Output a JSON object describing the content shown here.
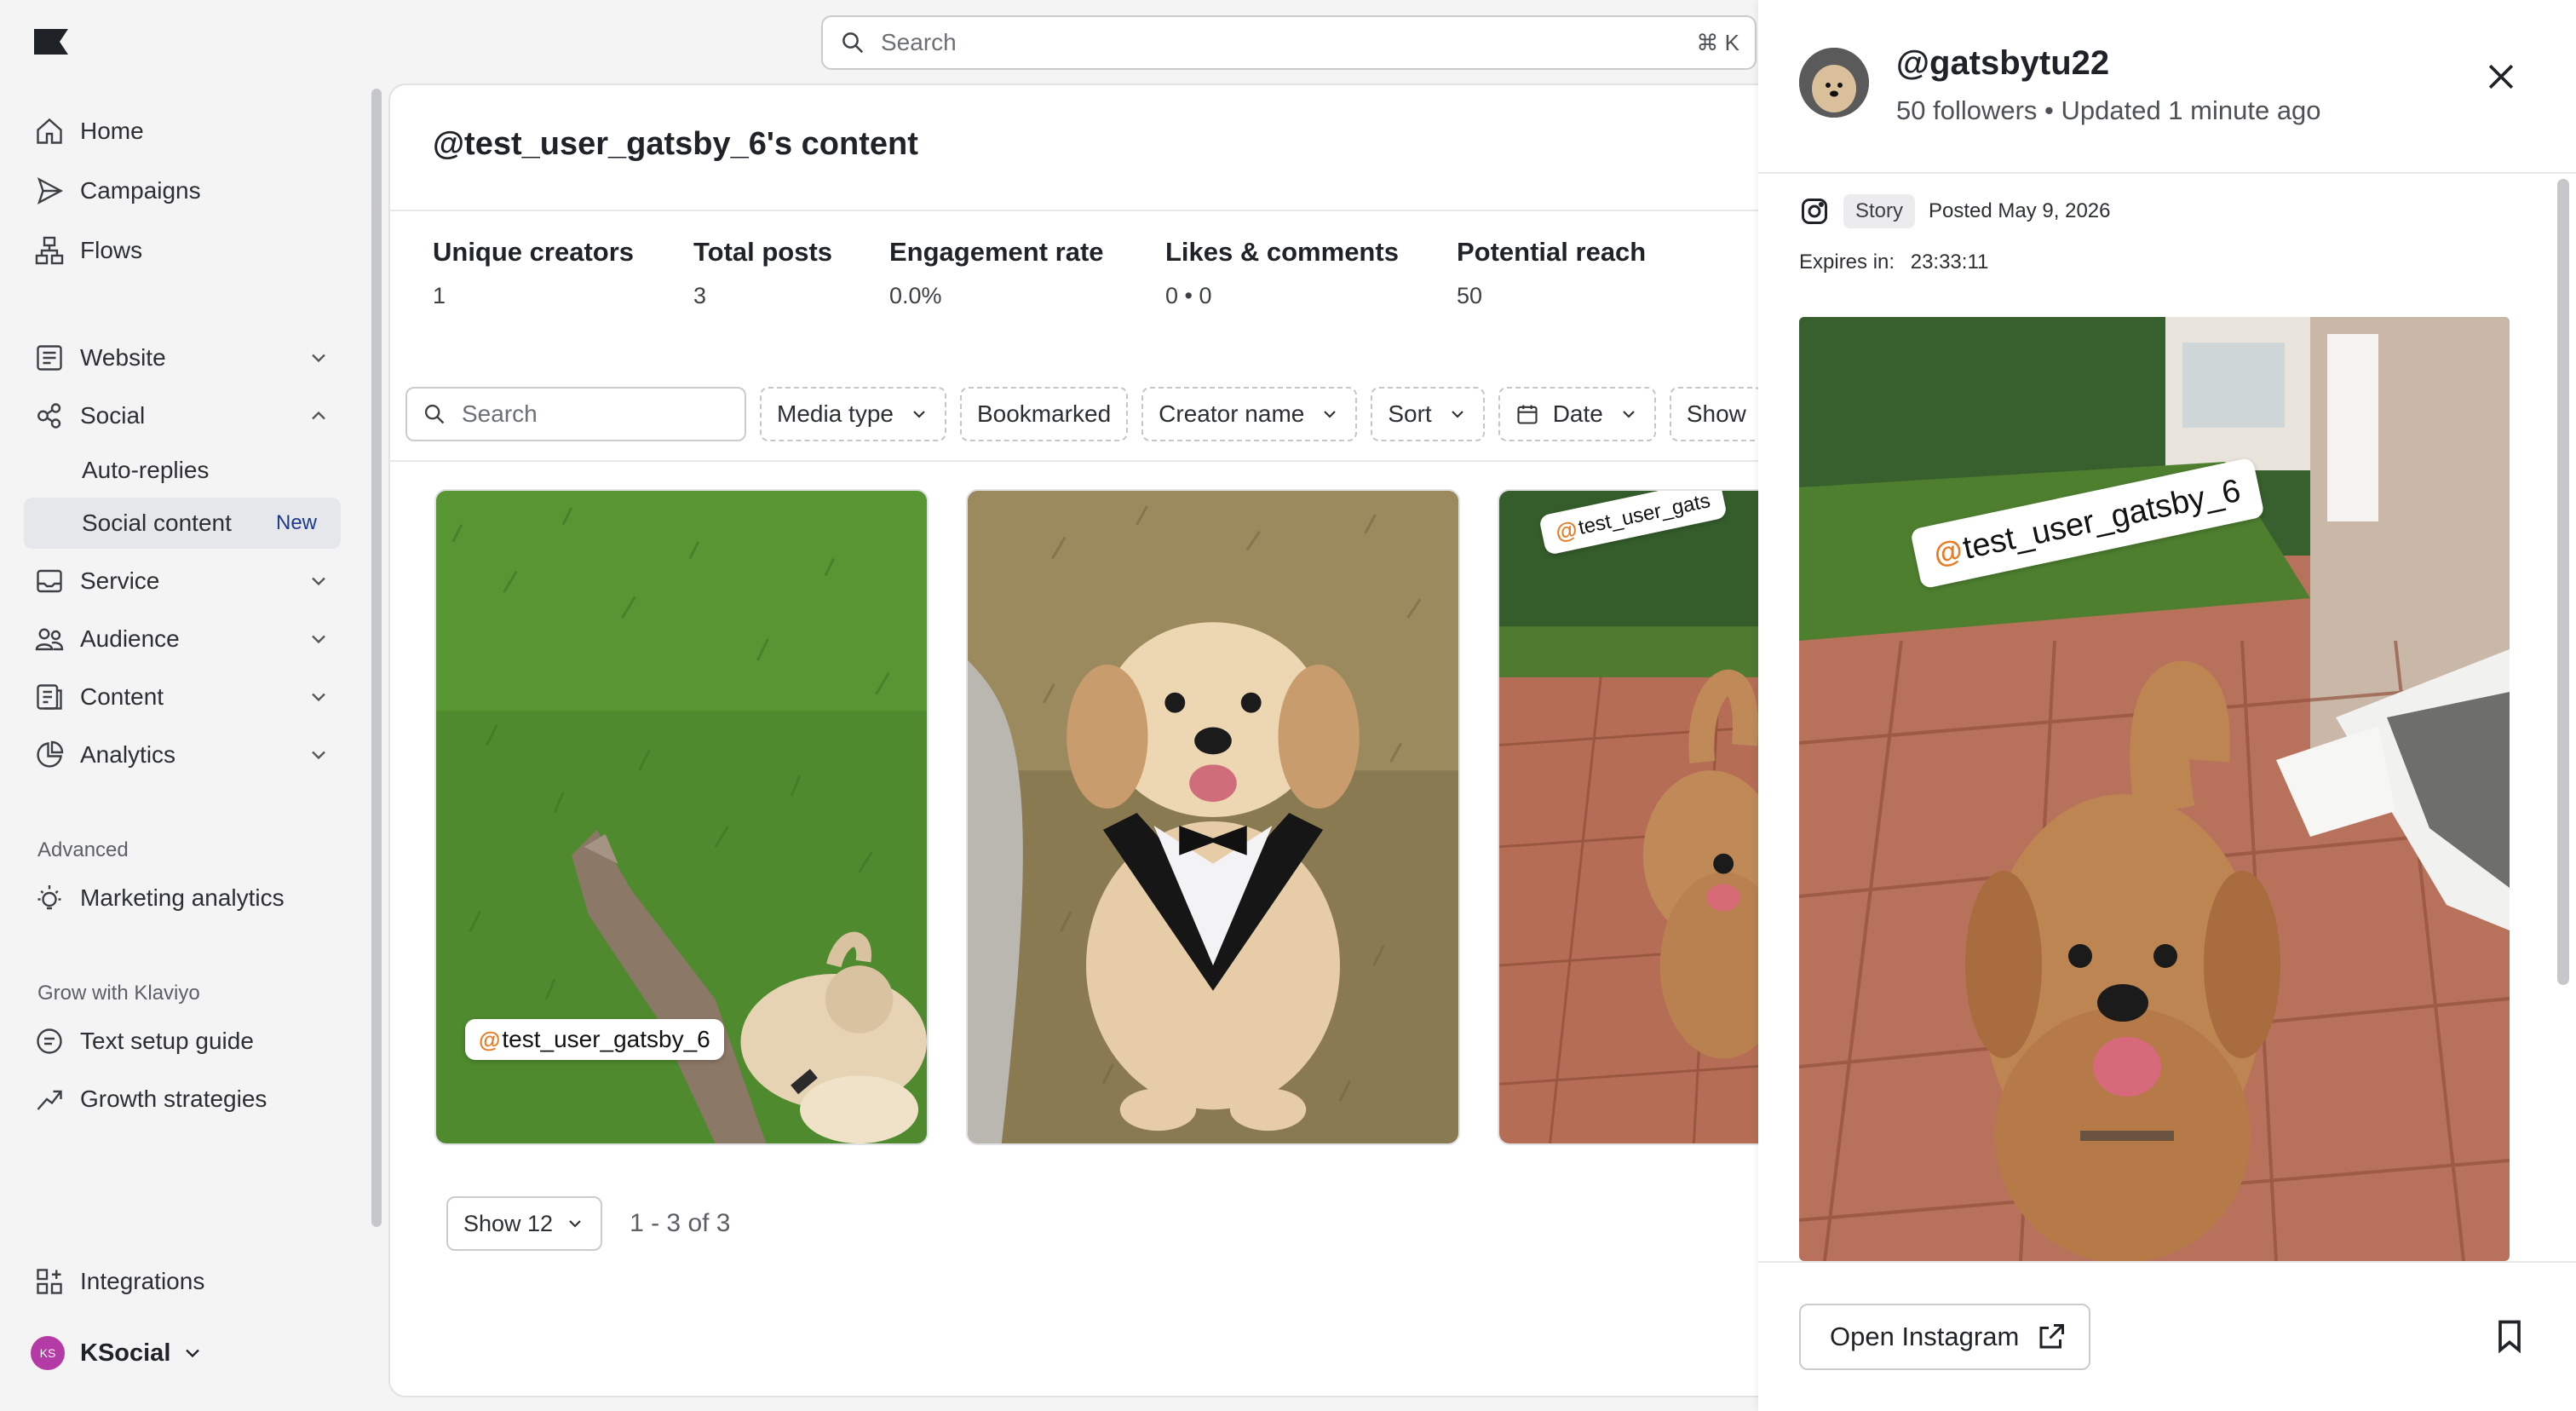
{
  "search": {
    "placeholder": "Search",
    "shortcut": "⌘ K"
  },
  "sidebar": {
    "items": [
      {
        "label": "Home",
        "icon": "home-icon"
      },
      {
        "label": "Campaigns",
        "icon": "send-icon"
      },
      {
        "label": "Flows",
        "icon": "flows-icon"
      },
      {
        "label": "Website",
        "icon": "website-icon"
      },
      {
        "label": "Social",
        "icon": "social-icon"
      },
      {
        "label": "Service",
        "icon": "inbox-icon"
      },
      {
        "label": "Audience",
        "icon": "audience-icon"
      },
      {
        "label": "Content",
        "icon": "content-icon"
      },
      {
        "label": "Analytics",
        "icon": "analytics-icon"
      }
    ],
    "social_sub": [
      {
        "label": "Auto-replies"
      },
      {
        "label": "Social content",
        "badge": "New"
      }
    ],
    "advanced_label": "Advanced",
    "advanced_items": [
      {
        "label": "Marketing analytics",
        "icon": "lightbulb-icon"
      }
    ],
    "grow_label": "Grow with Klaviyo",
    "grow_items": [
      {
        "label": "Text setup guide",
        "icon": "guide-icon"
      },
      {
        "label": "Growth strategies",
        "icon": "trend-icon"
      }
    ],
    "integrations": {
      "label": "Integrations",
      "icon": "integrations-icon"
    },
    "account": {
      "initials": "KS",
      "name": "KSocial"
    }
  },
  "main": {
    "title": "@test_user_gatsby_6's content",
    "stats": [
      {
        "label": "Unique creators",
        "value": "1"
      },
      {
        "label": "Total posts",
        "value": "3"
      },
      {
        "label": "Engagement rate",
        "value": "0.0%"
      },
      {
        "label": "Likes & comments",
        "value": "0 • 0"
      },
      {
        "label": "Potential reach",
        "value": "50"
      }
    ],
    "filters": {
      "search_placeholder": "Search",
      "chips": [
        "Media type",
        "Bookmarked",
        "Creator name",
        "Sort",
        "Date",
        "Show"
      ]
    },
    "tags": [
      "test_user_gatsby_6",
      "test_user_gats"
    ],
    "pager": {
      "show_label": "Show 12",
      "count": "1 - 3 of 3"
    }
  },
  "drawer": {
    "handle": "@gatsbytu22",
    "meta": "50 followers • Updated 1 minute ago",
    "media_type": "Story",
    "posted": "Posted May 9, 2026",
    "expires_label": "Expires in:",
    "expires_value": "23:33:11",
    "tag": "test_user_gatsby_6",
    "open_label": "Open Instagram"
  },
  "colors": {
    "accent_at": "#e97b22",
    "avatar_bg": "#b43aa6",
    "active_nav": "#e6e7ea"
  }
}
